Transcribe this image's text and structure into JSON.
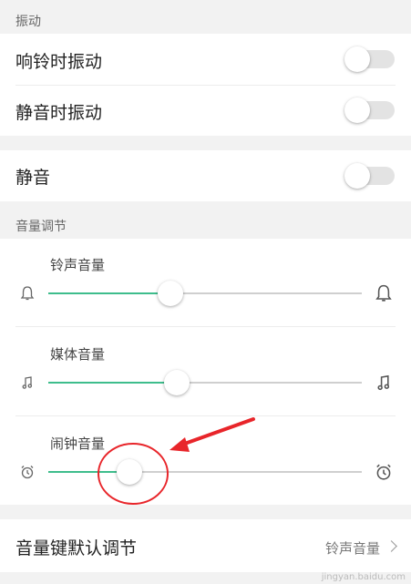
{
  "section_vibration": "振动",
  "vibrate_on_ring": {
    "label": "响铃时振动",
    "on": false
  },
  "vibrate_on_silent": {
    "label": "静音时振动",
    "on": false
  },
  "mute": {
    "label": "静音",
    "on": false
  },
  "section_volume": "音量调节",
  "ringtone_volume": {
    "label": "铃声音量",
    "level": 0.39,
    "icon": "bell-icon"
  },
  "media_volume": {
    "label": "媒体音量",
    "level": 0.41,
    "icon": "music-note-icon"
  },
  "alarm_volume": {
    "label": "闹钟音量",
    "level": 0.26,
    "icon": "alarm-clock-icon"
  },
  "volume_key_default": {
    "label": "音量键默认调节",
    "value": "铃声音量"
  },
  "accent_color": "#3ebd8c",
  "annotation_color": "#e8252a",
  "watermark": "jingyan.baidu.com"
}
